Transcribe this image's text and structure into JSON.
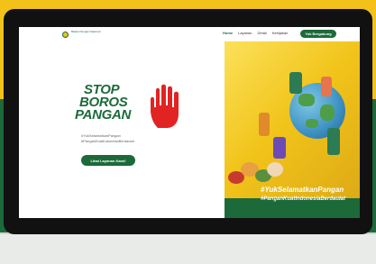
{
  "nav": {
    "logo_text": "Badan Pangan Nasional",
    "links": [
      "Home",
      "Layanan",
      "Detail",
      "Kebijakan"
    ],
    "cta": "Yuk Bergabung"
  },
  "hero": {
    "title_line1": "STOP",
    "title_line2": "BOROS",
    "title_line3": "PANGAN",
    "hashtag1": "#YukSelamatkanPangan",
    "hashtag2": "#PanganKuatIndonesiaBerdaulat",
    "button": "Lihat Layanan Kami!"
  },
  "banner": {
    "tag1": "#YukSelamatkanPangan",
    "tag2": "#PanganKuatIndonesiaBerdaulat"
  },
  "colors": {
    "brand_green": "#1c6a3a",
    "brand_yellow": "#f2c21b",
    "stop_red": "#e22323"
  }
}
